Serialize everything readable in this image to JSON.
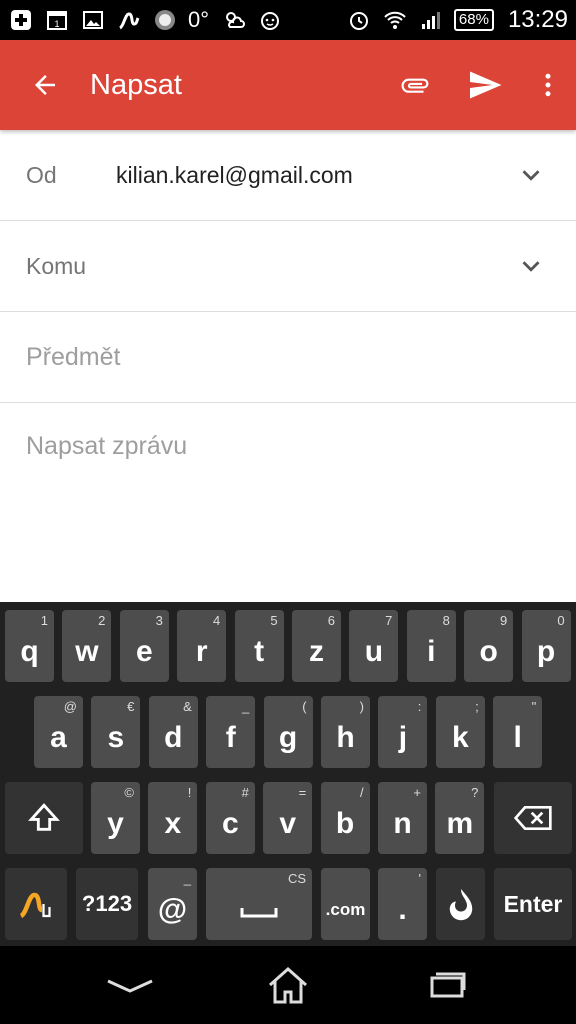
{
  "status_bar": {
    "temperature": "0°",
    "battery": "68%",
    "time": "13:29"
  },
  "app_bar": {
    "title": "Napsat"
  },
  "compose": {
    "from_label": "Od",
    "from_value": "kilian.karel@gmail.com",
    "to_label": "Komu",
    "subject_placeholder": "Předmět",
    "body_placeholder": "Napsat zprávu"
  },
  "keyboard": {
    "row1": [
      {
        "k": "q",
        "s": "1"
      },
      {
        "k": "w",
        "s": "2"
      },
      {
        "k": "e",
        "s": "3"
      },
      {
        "k": "r",
        "s": "4"
      },
      {
        "k": "t",
        "s": "5"
      },
      {
        "k": "z",
        "s": "6"
      },
      {
        "k": "u",
        "s": "7"
      },
      {
        "k": "i",
        "s": "8"
      },
      {
        "k": "o",
        "s": "9"
      },
      {
        "k": "p",
        "s": "0"
      }
    ],
    "row2": [
      {
        "k": "a",
        "s": "@"
      },
      {
        "k": "s",
        "s": "€"
      },
      {
        "k": "d",
        "s": "&"
      },
      {
        "k": "f",
        "s": "_"
      },
      {
        "k": "g",
        "s": "("
      },
      {
        "k": "h",
        "s": ")"
      },
      {
        "k": "j",
        "s": ":"
      },
      {
        "k": "k",
        "s": ";"
      },
      {
        "k": "l",
        "s": "\""
      }
    ],
    "row3": [
      {
        "k": "y",
        "s": "©"
      },
      {
        "k": "x",
        "s": "!"
      },
      {
        "k": "c",
        "s": "#"
      },
      {
        "k": "v",
        "s": "="
      },
      {
        "k": "b",
        "s": "/"
      },
      {
        "k": "n",
        "s": "+"
      },
      {
        "k": "m",
        "s": "?"
      }
    ],
    "symbols_label": "?123",
    "at_label": "@",
    "at_sub": "_",
    "space_sub": "CS",
    "dotcom_label": ".com",
    "period_label": ".",
    "period_sub": "'",
    "enter_label": "Enter"
  }
}
